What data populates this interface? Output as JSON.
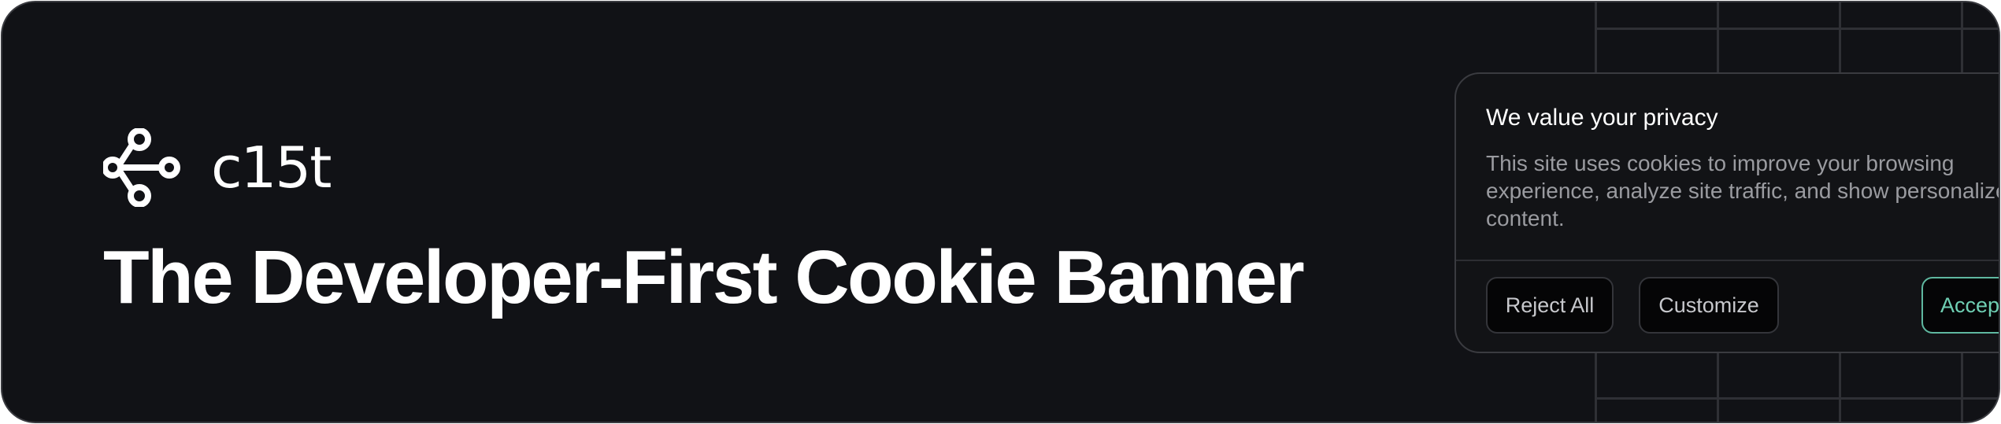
{
  "brand": {
    "wordmark": "c15t",
    "logo_icon": "branching-nodes-icon",
    "headline": "The Developer-First Cookie Banner"
  },
  "cookie_banner": {
    "title": "We value your privacy",
    "body": "This site uses cookies to improve your browsing experience, analyze site traffic, and show personalized content.",
    "buttons": {
      "reject_label": "Reject All",
      "customize_label": "Customize",
      "accept_label": "Accept All"
    }
  },
  "colors": {
    "background": "#111216",
    "accent": "#6fcfb3",
    "text_primary": "#ffffff",
    "text_muted": "#9a9ba0"
  }
}
